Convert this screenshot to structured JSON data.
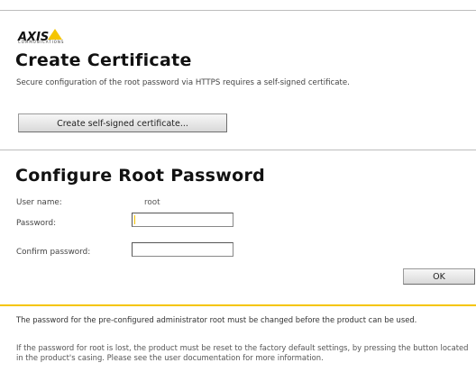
{
  "brand": {
    "logo_text": "AXIS",
    "logo_tagline": "COMMUNICATIONS",
    "accent_color": "#f5c500"
  },
  "certificate": {
    "title": "Create Certificate",
    "description": "Secure configuration of the root password via HTTPS requires a self-signed certificate.",
    "button_label": "Create self-signed certificate..."
  },
  "root_password": {
    "title": "Configure Root Password",
    "user_name_label": "User name:",
    "user_name_value": "root",
    "password_label": "Password:",
    "password_value": "",
    "confirm_label": "Confirm password:",
    "confirm_value": "",
    "ok_label": "OK"
  },
  "notes": {
    "note1": "The password for the pre-configured administrator root must be changed before the product can be used.",
    "note2": "If the password for root is lost, the product must be reset to the factory default settings, by pressing the button located in the product's casing. Please see the user documentation for more information."
  }
}
